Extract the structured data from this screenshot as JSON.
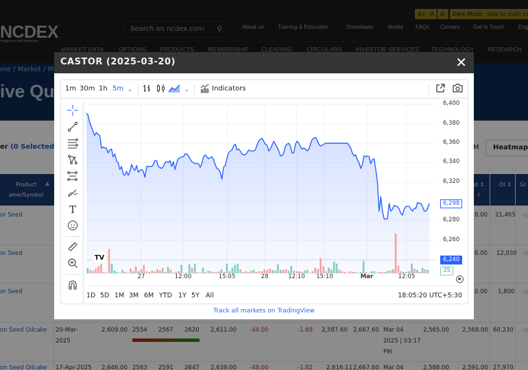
{
  "site": {
    "logo": "NCDEX",
    "logo_tagline": "Pragati ka Sahi Exchange",
    "search_placeholder": "Search on ncdex.com",
    "accessibility": [
      "A+",
      "A",
      "A-",
      "Dark Mode",
      "Skip to main con"
    ],
    "utility_nav": [
      "About us",
      "Training & Education",
      "Downloads",
      "Media",
      "FAQs",
      "Careers",
      "Get In Touch",
      "Eng"
    ],
    "main_nav": [
      "MARKET DATA",
      "OPTIONS",
      "PRODUCTS",
      "MEMBERSHIP",
      "CLEARING",
      "CIRCULARS",
      "INVESTOR SERVICES",
      "TECHNOLOGY",
      "RESEARCH"
    ],
    "breadcrumb": "me / Market / M",
    "hero_title": "ive Qu",
    "filter_label": "er ",
    "filter_selected": "(0 Selected)",
    "m_label": "M",
    "heatmap_button": "Heatmap",
    "table": {
      "headers": {
        "product": "Product",
        "product2": "ame/Symbol",
        "last": "st",
        "last2": "l",
        "oi": "OI",
        "gr": "Gr"
      },
      "rows": [
        {
          "product": "or Seed",
          "last": "8.00",
          "oi": "21,465"
        },
        {
          "product": "or Seed",
          "last": "6.00",
          "oi": "12,030"
        },
        {
          "product": "or Seed",
          "last": "0.00",
          "oi": "1,800"
        },
        {
          "product": "on Seed Oilcake",
          "expiry": "20-Mar-",
          "expiry2": "2025",
          "open": "2,609.00",
          "low": "2554",
          "ltp": "2567",
          "high": "2620",
          "prev": "2,611.00",
          "chg": "-44.00",
          "pct": "-1.69",
          "c1": "2,587.60",
          "c2": "2,667.60",
          "time1": "Mar 04",
          "time2": "2025 | 03:17",
          "time3": "PM",
          "bid": "2,565.00",
          "ask": "2,568.00",
          "oi": "60,230"
        },
        {
          "product": "on Seed Oilcake",
          "expiry": "17-Apr-2025",
          "open": "2,646.00",
          "low": "2583",
          "ltp": "2591",
          "high": "2647",
          "prev": "2,639.00",
          "chg": "-48.00",
          "pct": "-1.82",
          "c1": "2,616.11",
          "c2": "2,667.60",
          "time1": "Mar 04",
          "bid": "2,588.00",
          "ask": "2,591.00",
          "oi": "27,970"
        }
      ]
    }
  },
  "modal": {
    "title": "CASTOR (2025-03-20)",
    "close_label": "✕",
    "toolbar": {
      "intervals": [
        "1m",
        "30m",
        "1h",
        "5m"
      ],
      "active_interval": "5m",
      "indicators_label": "Indicators"
    },
    "left_tools": [
      "crosshair-icon",
      "trend-line-icon",
      "fib-lines-icon",
      "pattern-icon",
      "projection-icon",
      "brush-icon",
      "text-icon",
      "emoji-icon",
      "ruler-icon",
      "zoom-in-icon",
      "magnet-icon"
    ],
    "range_buttons": [
      "1D",
      "5D",
      "1M",
      "3M",
      "6M",
      "YTD",
      "1Y",
      "5Y",
      "All"
    ],
    "clock": "18:05:20 UTC+5:30",
    "link_text": "Track all markets on TradingView",
    "colors": {
      "line": "#2962ff",
      "up_volume": "#7fcfbf",
      "down_volume": "#f4a3a0",
      "accent": "#2962ff"
    }
  },
  "chart_data": {
    "type": "area",
    "title": "CASTOR (2025-03-20)",
    "interval": "5m",
    "y_ticks": [
      "6,400",
      "6,380",
      "6,360",
      "6,340",
      "6,320",
      "6,280",
      "6,260"
    ],
    "ylim": [
      6226,
      6403
    ],
    "x_ticks": [
      {
        "label": "27",
        "pos": 0.16,
        "bold": false
      },
      {
        "label": "12:00",
        "pos": 0.282,
        "bold": false
      },
      {
        "label": "15:05",
        "pos": 0.41,
        "bold": false
      },
      {
        "label": "28",
        "pos": 0.52,
        "bold": false
      },
      {
        "label": "12:10",
        "pos": 0.613,
        "bold": false
      },
      {
        "label": "15:10",
        "pos": 0.695,
        "bold": false
      },
      {
        "label": "Mar",
        "pos": 0.818,
        "bold": true
      },
      {
        "label": "12:05",
        "pos": 0.934,
        "bold": false
      }
    ],
    "last_price": "6,298",
    "last_price_value": 6298,
    "crosshair_price": "6,240",
    "crosshair_value": 6240,
    "volume_last": "35",
    "price_series": [
      6391,
      6389,
      6381,
      6377,
      6372,
      6368,
      6371,
      6369,
      6368,
      6355,
      6356,
      6355,
      6355,
      6350,
      6353,
      6354,
      6346,
      6349,
      6342,
      6340,
      6333,
      6336,
      6328,
      6327,
      6331,
      6327,
      6331,
      6338,
      6334,
      6332,
      6337,
      6330,
      6332,
      6333,
      6331,
      6325,
      6336,
      6336,
      6336,
      6336,
      6338,
      6342,
      6342,
      6336,
      6335,
      6334,
      6336,
      6340,
      6341,
      6340,
      6342,
      6336,
      6341,
      6333,
      6340,
      6344,
      6345,
      6346,
      6346,
      6349,
      6349,
      6347,
      6344,
      6341,
      6340,
      6339,
      6339,
      6339,
      6335,
      6339,
      6346,
      6348,
      6346,
      6344,
      6345,
      6346,
      6343,
      6338,
      6334,
      6333,
      6330,
      6323,
      6335,
      6337,
      6344,
      6350,
      6352,
      6353,
      6357,
      6359,
      6353,
      6354,
      6352,
      6349,
      6348,
      6348,
      6350,
      6353,
      6352,
      6352,
      6352,
      6353,
      6358,
      6362,
      6364,
      6365,
      6362,
      6359,
      6358,
      6352,
      6354,
      6358,
      6362,
      6359,
      6356,
      6352,
      6347,
      6347,
      6350,
      6357,
      6359,
      6360,
      6357,
      6350,
      6350,
      6359,
      6362,
      6360,
      6356,
      6354,
      6355,
      6354,
      6352,
      6354,
      6359,
      6364,
      6365,
      6366,
      6363,
      6359,
      6357,
      6358,
      6359,
      6360,
      6360,
      6360,
      6360,
      6360,
      6360,
      6360,
      6360,
      6360,
      6360,
      6360,
      6360,
      6360,
      6360,
      6358,
      6355,
      6350,
      6347,
      6348,
      6343,
      6340,
      6334,
      6338,
      6347,
      6346,
      6347,
      6346,
      6339,
      6343,
      6344,
      6333,
      6320,
      6290,
      6305,
      6290,
      6282,
      6282,
      6282,
      6298,
      6290,
      6292,
      6296,
      6295,
      6295,
      6292,
      6288,
      6286,
      6292,
      6295,
      6295,
      6295,
      6292,
      6290,
      6293,
      6293,
      6299,
      6298,
      6298,
      6295,
      6290,
      6290,
      6293,
      6298
    ],
    "volume_series": [
      8,
      5,
      4,
      7,
      10,
      13,
      2,
      1,
      35,
      14,
      4,
      2,
      1,
      5,
      2,
      1,
      7,
      3,
      10,
      3,
      6,
      12,
      3,
      2,
      4,
      3,
      6,
      4,
      8,
      2,
      9,
      5,
      1,
      2,
      3,
      12,
      1,
      1,
      13,
      8,
      14,
      2,
      1,
      8,
      2,
      4,
      3,
      2,
      2,
      3,
      6,
      2,
      14,
      3,
      8,
      12,
      14,
      6,
      2,
      3,
      2,
      4,
      5,
      2,
      3,
      3,
      6,
      5,
      7,
      5,
      4,
      13,
      5,
      5,
      6,
      4,
      11,
      4,
      3,
      3,
      2,
      4,
      5,
      1,
      3,
      8,
      6,
      22,
      10,
      3,
      8,
      6,
      17,
      14,
      5,
      3,
      2,
      1,
      3,
      2,
      2,
      1,
      2,
      18,
      2,
      1,
      3,
      3,
      1,
      2,
      2,
      2,
      4,
      4,
      6,
      57,
      11,
      3,
      2,
      2,
      3,
      14,
      7,
      5,
      2,
      8,
      6,
      5
    ],
    "volume_up": [
      true,
      false,
      false,
      false,
      false,
      false,
      true,
      false,
      false,
      true,
      true,
      true,
      false,
      true,
      false,
      true,
      false,
      true,
      false,
      true,
      false,
      false,
      false,
      true,
      false,
      false,
      false,
      true,
      false,
      true,
      true,
      false,
      true,
      false,
      false,
      true,
      false,
      true,
      true,
      false,
      true,
      false,
      true,
      true,
      false,
      false,
      true,
      false,
      false,
      false,
      true,
      false,
      true,
      false,
      true,
      true,
      true,
      false,
      true,
      false,
      false,
      false,
      true,
      false,
      false,
      false,
      false,
      false,
      false,
      true,
      false,
      true,
      true,
      false,
      false,
      true,
      true,
      false,
      false,
      true,
      false,
      true,
      true,
      false,
      false,
      false,
      false,
      false,
      false,
      false,
      true,
      true,
      true,
      true,
      false,
      false,
      false,
      false,
      false,
      false,
      true,
      false,
      true,
      true,
      false,
      false,
      true,
      true,
      false,
      false,
      false,
      true,
      false,
      false,
      true,
      false,
      false,
      false,
      true,
      false,
      true,
      true,
      false,
      true,
      false,
      true,
      false,
      true
    ]
  }
}
